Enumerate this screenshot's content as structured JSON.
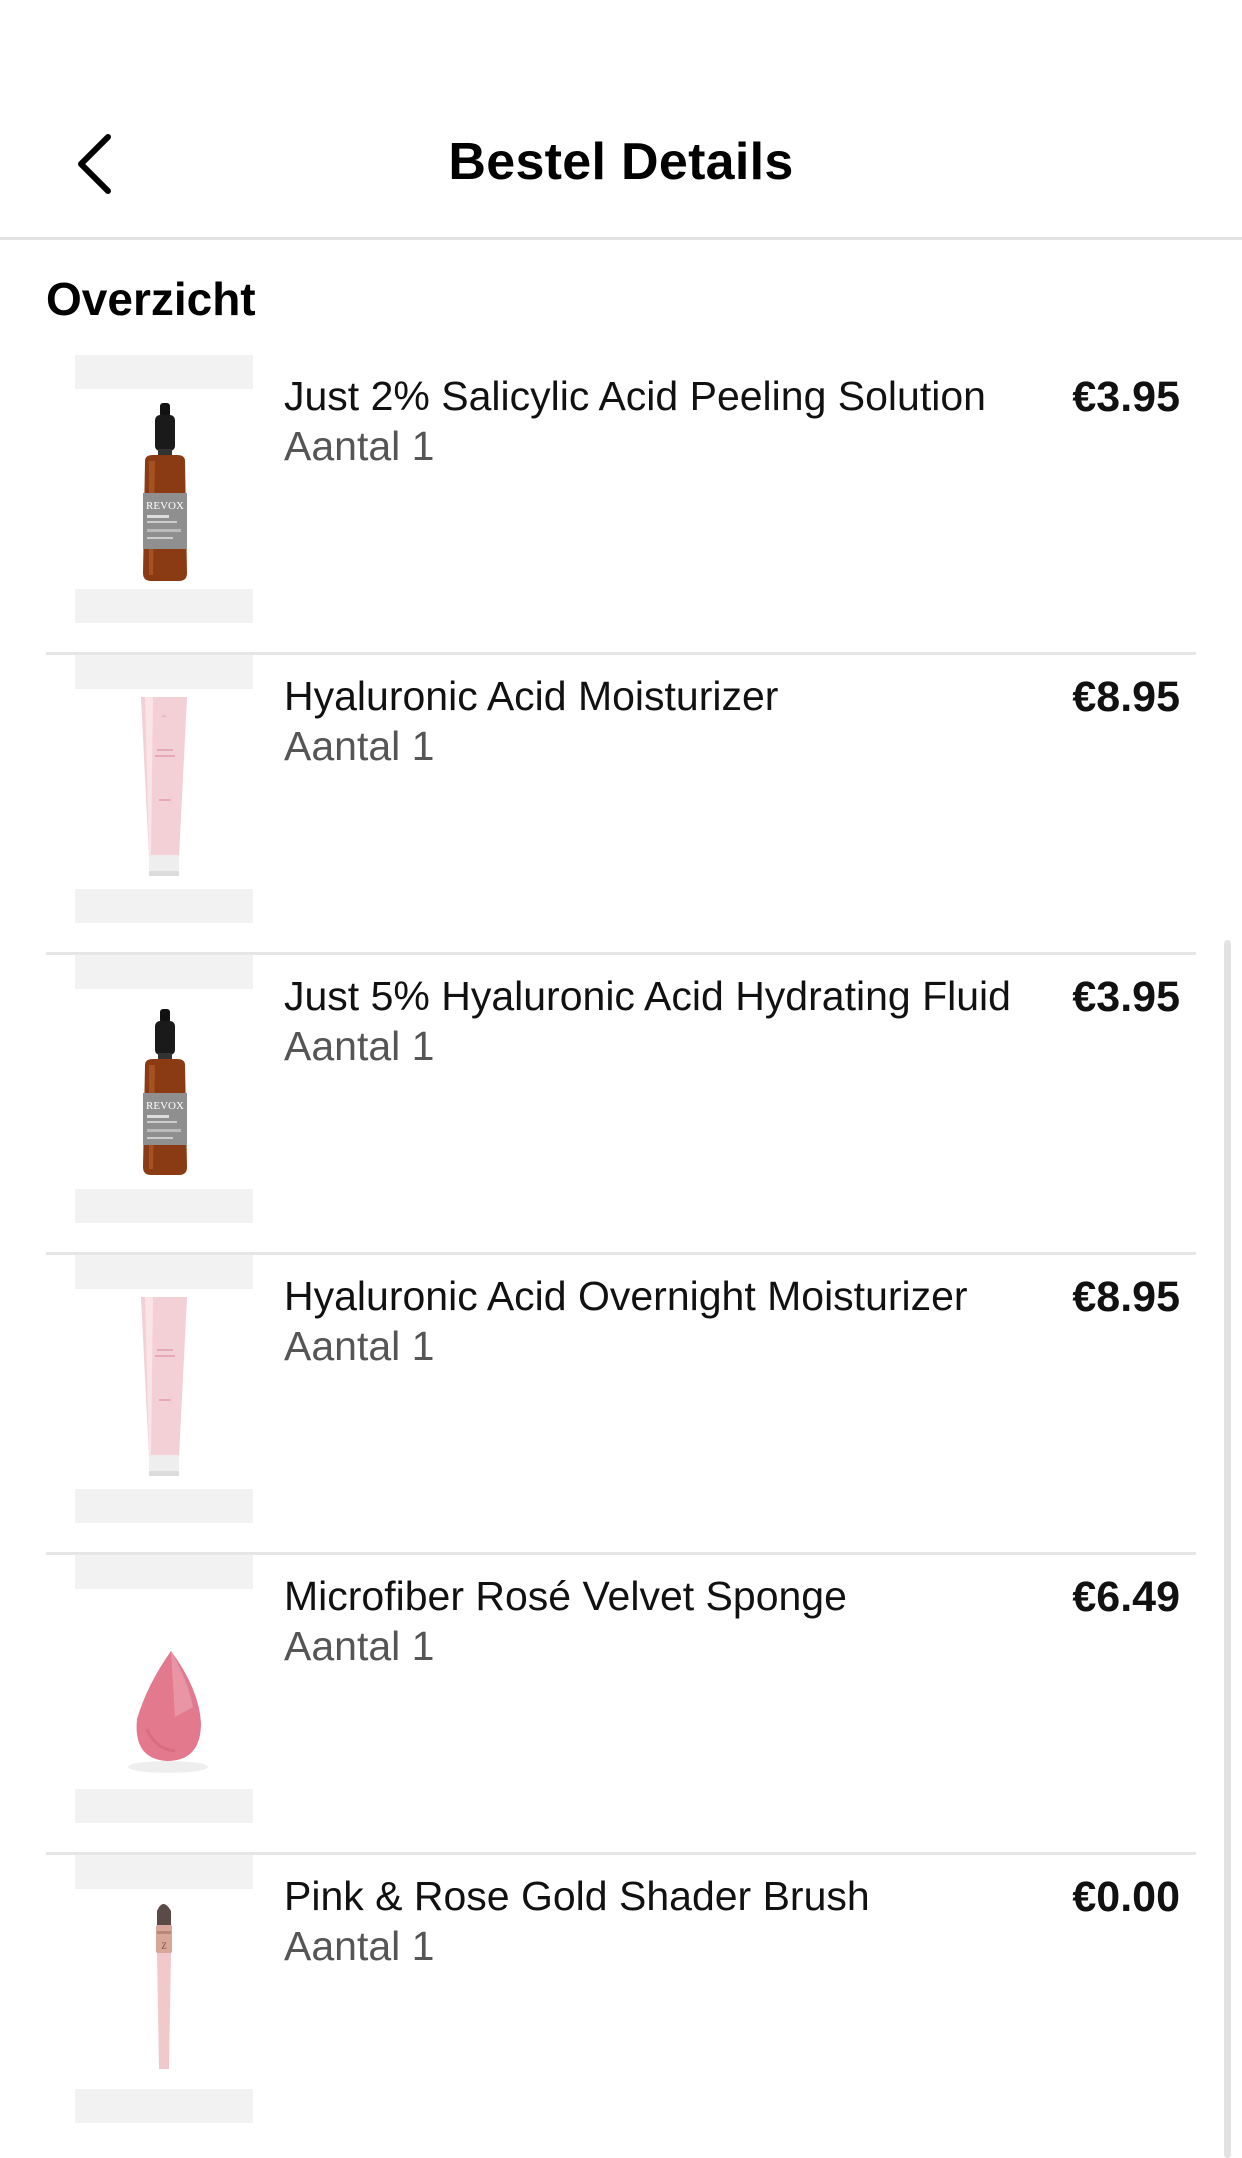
{
  "header": {
    "title": "Bestel Details",
    "back_icon": "chevron-left-icon"
  },
  "section": {
    "title": "Overzicht"
  },
  "items": [
    {
      "name": "Just 2%  Salicylic Acid Peeling Solution",
      "quantity": "Aantal 1",
      "price": "€3.95",
      "image": "serum-bottle"
    },
    {
      "name": "Hyaluronic Acid Moisturizer",
      "quantity": "Aantal 1",
      "price": "€8.95",
      "image": "pink-tube"
    },
    {
      "name": "Just 5% Hyaluronic Acid Hydrating Fluid",
      "quantity": "Aantal 1",
      "price": "€3.95",
      "image": "serum-bottle"
    },
    {
      "name": "Hyaluronic Acid Overnight Moisturizer",
      "quantity": "Aantal 1",
      "price": "€8.95",
      "image": "pink-tube"
    },
    {
      "name": "Microfiber Rosé Velvet Sponge",
      "quantity": "Aantal 1",
      "price": "€6.49",
      "image": "makeup-sponge"
    },
    {
      "name": "Pink & Rose Gold Shader Brush",
      "quantity": "Aantal 1",
      "price": "€0.00",
      "image": "makeup-brush"
    }
  ],
  "bottle_label": "REVOX"
}
